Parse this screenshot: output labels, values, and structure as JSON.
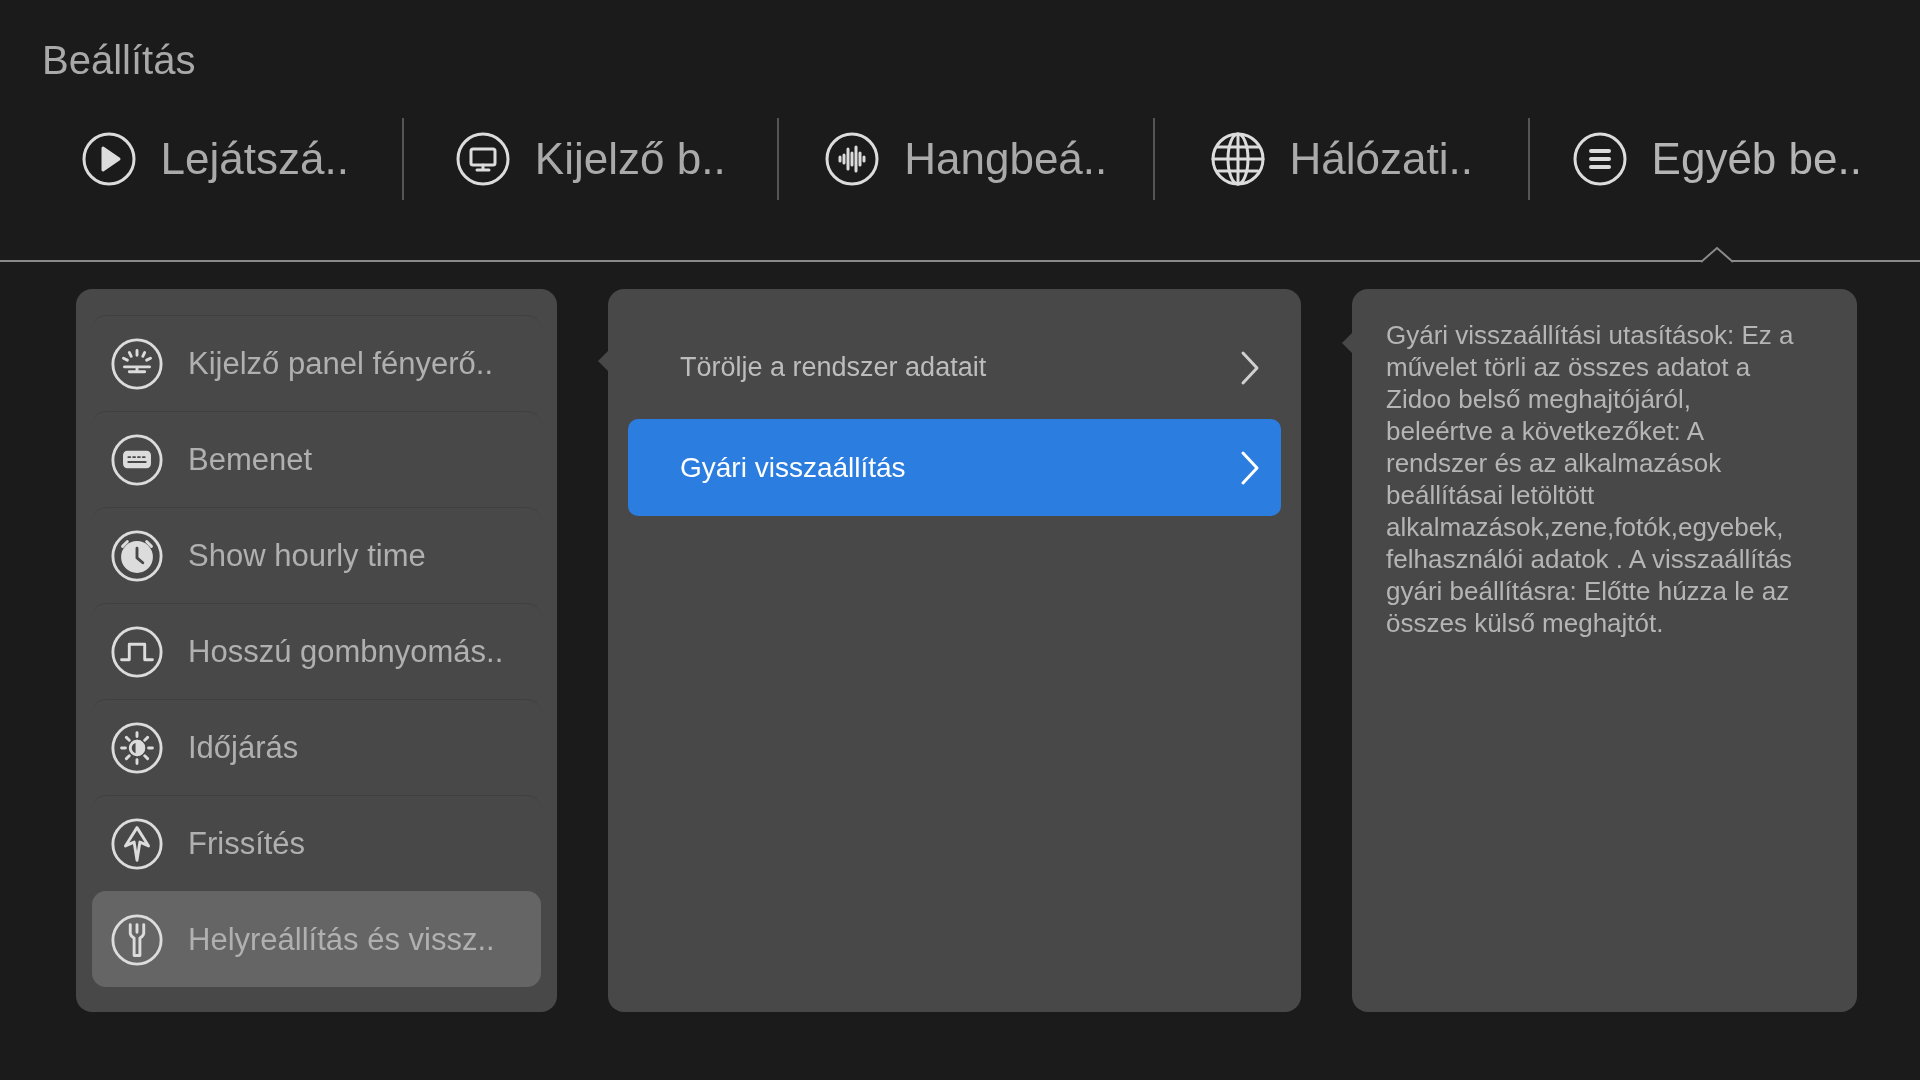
{
  "header": {
    "title": "Beállítás"
  },
  "tabs": [
    {
      "label": "Lejátszá..",
      "selected": false
    },
    {
      "label": "Kijelző b..",
      "selected": false
    },
    {
      "label": "Hangbeá..",
      "selected": false
    },
    {
      "label": "Hálózati..",
      "selected": false
    },
    {
      "label": "Egyéb be..",
      "selected": true
    }
  ],
  "sidebar": {
    "items": [
      {
        "label": "Kijelző panel fényerő..",
        "selected": false
      },
      {
        "label": "Bemenet",
        "selected": false
      },
      {
        "label": "Show hourly time",
        "selected": false
      },
      {
        "label": "Hosszú gombnyomás..",
        "selected": false
      },
      {
        "label": "Időjárás",
        "selected": false
      },
      {
        "label": "Frissítés",
        "selected": false
      },
      {
        "label": "Helyreállítás és vissz..",
        "selected": true
      }
    ]
  },
  "options": {
    "items": [
      {
        "label": "Törölje a rendszer adatait",
        "selected": false
      },
      {
        "label": "Gyári visszaállítás",
        "selected": true
      }
    ]
  },
  "description": {
    "text": "Gyári visszaállítási utasítások: Ez a művelet törli az összes adatot a Zidoo belső meghajtójáról, beleértve a következőket: A rendszer és az alkalmazások beállításai letöltött alkalmazások,zene,fotók,egyebek, felhasználói adatok . A visszaállítás gyári beállításra: Előtte húzza le az összes külső meghajtót."
  }
}
